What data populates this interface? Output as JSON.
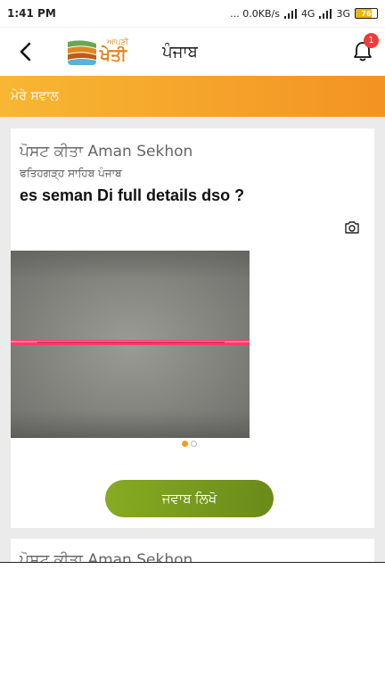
{
  "status_bar": {
    "time": "1:41 PM",
    "indicators": "... 0.0KB/s",
    "network_1": "4G",
    "network_2": "3G",
    "battery": "76"
  },
  "header": {
    "logo_small": "ਆਪਣੀ",
    "logo_big": "ਖੇਤੀ",
    "title": "ਪੰਜਾਬ",
    "notification_count": "1"
  },
  "section": {
    "title": "ਮੇਰੇ ਸਵਾਲ"
  },
  "posts": [
    {
      "posted_by": "ਪੋਸਟ ਕੀਤਾ Aman Sekhon",
      "location": "ਫਤਿਹਗੜ੍ਹ ਸਾਹਿਬ ਪੰਜਾਬ",
      "question": "es seman Di full details dso ?",
      "image_count": 2,
      "active_image": 1,
      "answer_label": "ਜਵਾਬ ਲਿਖੋ"
    },
    {
      "posted_by": "ਪੋਸਟ ਕੀਤਾ Aman Sekhon"
    }
  ],
  "colors": {
    "accent_orange": "#f5a12a",
    "answer_green": "#7a9b1f",
    "badge_red": "#ef3b3b"
  },
  "icons": [
    "back-arrow-icon",
    "bell-icon",
    "camera-icon"
  ]
}
